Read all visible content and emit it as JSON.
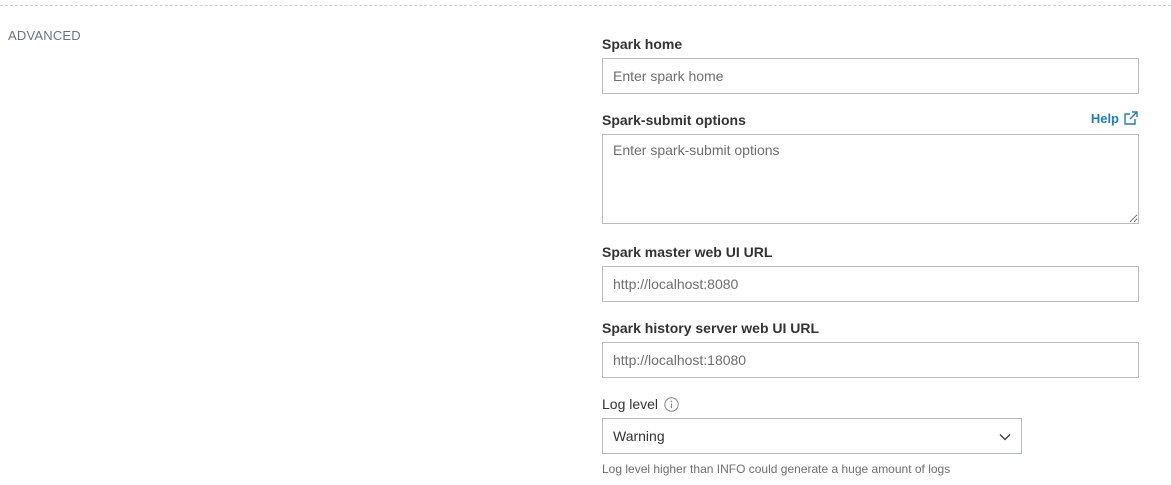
{
  "section": {
    "title": "ADVANCED"
  },
  "fields": {
    "spark_home": {
      "label": "Spark home",
      "placeholder": "Enter spark home",
      "value": ""
    },
    "spark_submit": {
      "label": "Spark-submit options",
      "placeholder": "Enter spark-submit options",
      "value": "",
      "help_label": "Help",
      "help_icon": "external-link-icon"
    },
    "master_url": {
      "label": "Spark master web UI URL",
      "placeholder": "http://localhost:8080",
      "value": ""
    },
    "history_url": {
      "label": "Spark history server web UI URL",
      "placeholder": "http://localhost:18080",
      "value": ""
    },
    "log_level": {
      "label": "Log level",
      "info_icon": "info-icon",
      "selected": "Warning",
      "dropdown_icon": "chevron-down-icon",
      "hint": "Log level higher than INFO could generate a huge amount of logs"
    }
  },
  "colors": {
    "link": "#1a7dbf",
    "border": "#b7bcc4",
    "section_label": "#6b7280",
    "placeholder": "#6e6e6e"
  }
}
